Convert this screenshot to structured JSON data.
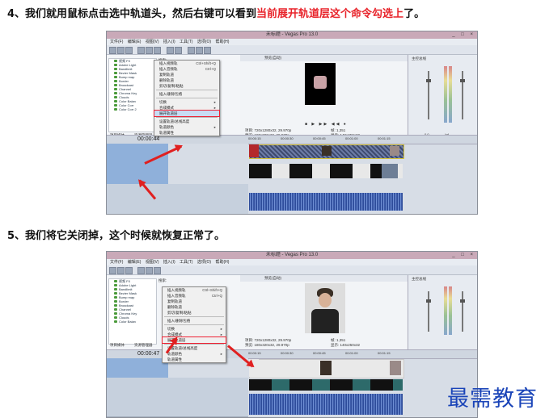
{
  "step4": {
    "prefix": "4、我们就用鼠标点击选中轨道头，然后右键可以看到",
    "highlight": "当前展开轨道层这个命令勾选上",
    "suffix": "了。"
  },
  "step5": {
    "text": "5、我们将它关闭掉，这个时候就恢复正常了。"
  },
  "window": {
    "title": "未标题 - Vegas Pro 13.0",
    "menu": [
      "文件(F)",
      "编辑(E)",
      "视图(V)",
      "插入(I)",
      "工具(T)",
      "选项(O)",
      "帮助(H)"
    ],
    "winbuttons": "_ □ ×"
  },
  "explorer": {
    "tree": [
      "视频 FX",
      "Adobe Light",
      "Bandlimit",
      "Bezier Mask",
      "Bump map",
      "Border",
      "Broadcast",
      "Channel",
      "Chroma Key",
      "Clouds",
      "Color Balan",
      "Color Corr",
      "Color Corr 2"
    ],
    "label": "搜索:",
    "tabs": [
      "项目媒体",
      "资源管理器"
    ]
  },
  "context_menu": {
    "items": [
      {
        "label": "插入视频轨",
        "shortcut": "Ctrl+Shift+Q"
      },
      {
        "label": "插入音频轨",
        "shortcut": "Ctrl+Q"
      },
      {
        "label": "复制轨道"
      },
      {
        "label": "删除轨道"
      },
      {
        "label": "剪切/复制/粘贴"
      },
      {
        "label": "插入/删除包络"
      },
      {
        "label": "切换",
        "shortcut": "▸"
      },
      {
        "label": "合成模式",
        "shortcut": "▸"
      },
      {
        "label": "展开轨道层"
      },
      {
        "label": "设置轨道/总线高度"
      },
      {
        "label": "轨道颜色",
        "shortcut": "▸"
      },
      {
        "label": "轨道属性"
      }
    ],
    "highlighted_index": 8
  },
  "preview": {
    "header": "预览(自动)",
    "info1": "项目: 720x1280x32, 29.970p",
    "info2": "预览: 180x320x32, 29.970p",
    "frame1": "帧: 1,351",
    "frame2": "显示: 140x250x32",
    "transport": "■ ▶ ▶▶ ◀◀ ●"
  },
  "mixer": {
    "title": "主控总线",
    "values": [
      "-Inf",
      "-Inf"
    ],
    "db": "0.0"
  },
  "timeline": {
    "timecode1": "00:00:44",
    "timecode2": "00:00:47",
    "ruler": [
      "00:00:15",
      "00:00:30",
      "00:00:45",
      "00:01:00",
      "00:01:15",
      "00:01:30",
      "00:01:45"
    ]
  },
  "watermark": "最需教育",
  "colors": {
    "accent_red": "#e8232a",
    "watermark_blue": "#1a44b8",
    "titlebar": "#c9a9b8"
  }
}
